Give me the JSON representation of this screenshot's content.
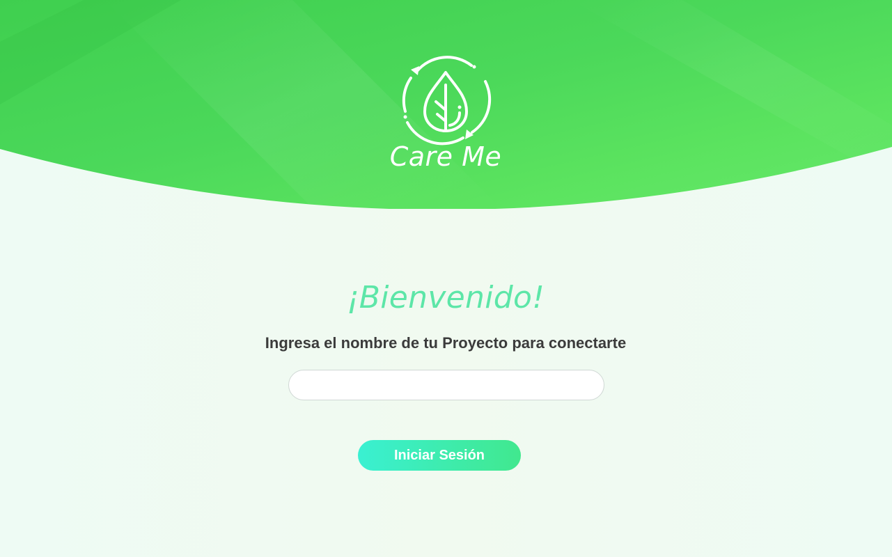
{
  "brand": {
    "name": "Care Me",
    "logo_icon": "recycle-leaf-icon"
  },
  "login": {
    "welcome": "¡Bienvenido!",
    "instruction": "Ingresa el nombre de tu Proyecto para conectarte",
    "project_input_value": "",
    "project_input_placeholder": "",
    "submit_label": "Iniciar Sesión"
  },
  "colors": {
    "header_green": "#4fd95a",
    "welcome_text": "#5de6a8",
    "button_gradient_start": "#3af0d2",
    "button_gradient_end": "#41e88e",
    "page_background": "#effaf2"
  }
}
